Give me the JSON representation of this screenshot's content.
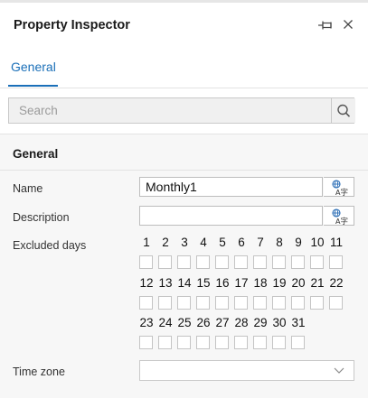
{
  "panel": {
    "title": "Property Inspector"
  },
  "tabs": [
    {
      "label": "General",
      "active": true
    }
  ],
  "search": {
    "placeholder": "Search",
    "value": ""
  },
  "section": {
    "title": "General"
  },
  "fields": {
    "name": {
      "label": "Name",
      "value": "Monthly1"
    },
    "description": {
      "label": "Description",
      "value": ""
    },
    "excluded_days": {
      "label": "Excluded days",
      "rows": [
        [
          "1",
          "2",
          "3",
          "4",
          "5",
          "6",
          "7",
          "8",
          "9",
          "10",
          "11"
        ],
        [
          "12",
          "13",
          "14",
          "15",
          "16",
          "17",
          "18",
          "19",
          "20",
          "21",
          "22"
        ],
        [
          "23",
          "24",
          "25",
          "26",
          "27",
          "28",
          "29",
          "30",
          "31"
        ]
      ],
      "checked": []
    },
    "time_zone": {
      "label": "Time zone",
      "value": ""
    }
  },
  "colors": {
    "accent": "#1a6fb8",
    "section_bg": "#f7f7f7",
    "border": "#c9c9c9"
  }
}
